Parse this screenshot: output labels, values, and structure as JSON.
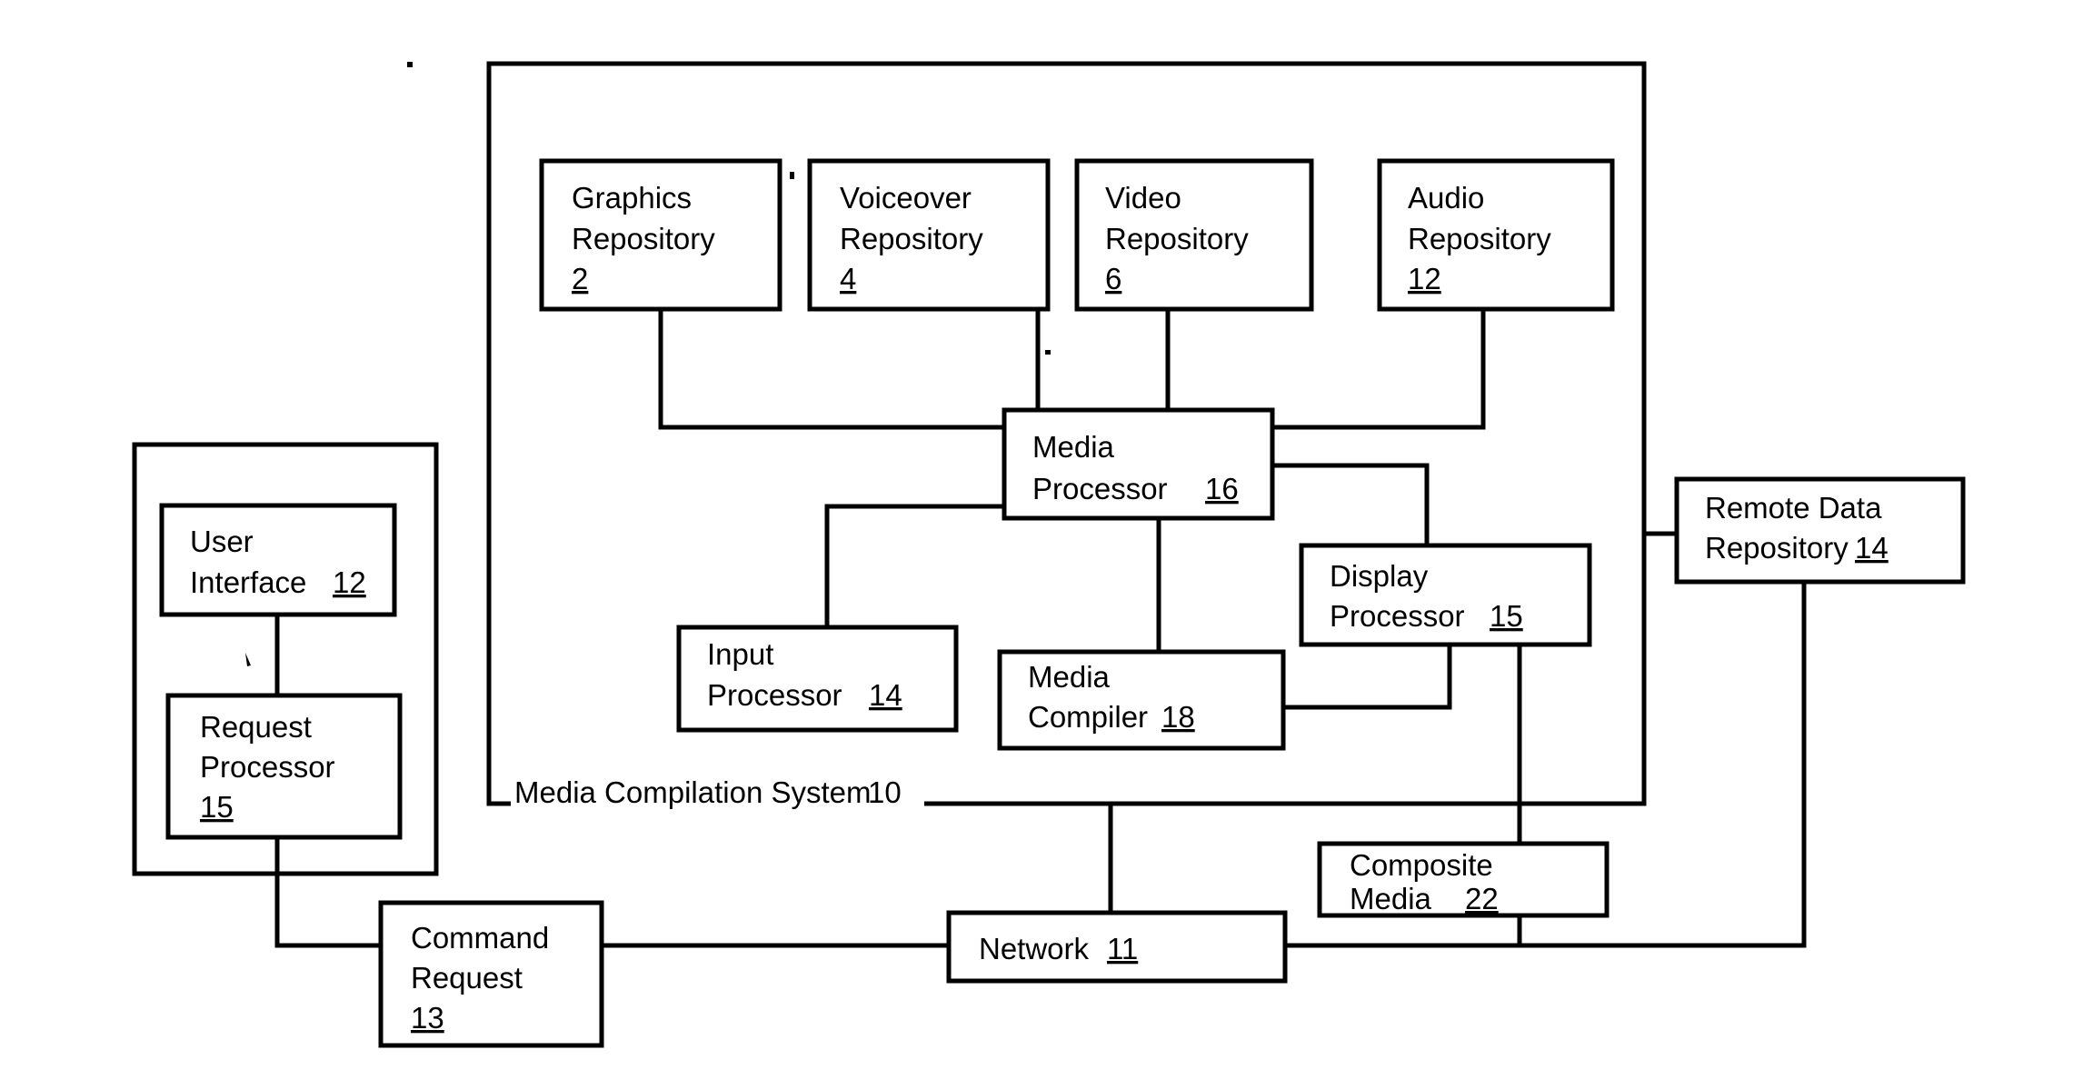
{
  "figure": {
    "kind": "patent-block-diagram",
    "system_label": "Media Compilation System 10",
    "system_label_text": "Media Compilation System",
    "system_label_ref": "10"
  },
  "blocks": {
    "graphics_repository": {
      "line1": "Graphics",
      "line2": "Repository",
      "ref": "2"
    },
    "voiceover_repository": {
      "line1": "Voiceover",
      "line2": "Repository",
      "ref": "4"
    },
    "video_repository": {
      "line1": "Video",
      "line2": "Repository",
      "ref": "6"
    },
    "audio_repository": {
      "line1": "Audio",
      "line2": "Repository",
      "ref": "12"
    },
    "media_processor": {
      "line1": "Media",
      "line2": "Processor",
      "ref": "16"
    },
    "input_processor": {
      "line1": "Input",
      "line2": "Processor",
      "ref": "14"
    },
    "media_compiler": {
      "line1": "Media",
      "line2": "Compiler",
      "ref": "18"
    },
    "display_processor": {
      "line1": "Display",
      "line2": "Processor",
      "ref": "15"
    },
    "remote_data_repository": {
      "line1": "Remote Data",
      "line2": "Repository",
      "ref": "14"
    },
    "user_interface": {
      "line1": "User",
      "line2": "Interface",
      "ref": "12"
    },
    "request_processor": {
      "line1": "Request",
      "line2": "Processor",
      "ref": "15"
    },
    "command_request": {
      "line1": "Command",
      "line2": "Request",
      "ref": "13"
    },
    "network": {
      "line1": "Network",
      "ref": "11"
    },
    "composite_media": {
      "line1": "Composite",
      "line2": "Media",
      "ref": "22"
    }
  },
  "colors": {
    "ink": "#000000",
    "paper": "#ffffff"
  }
}
